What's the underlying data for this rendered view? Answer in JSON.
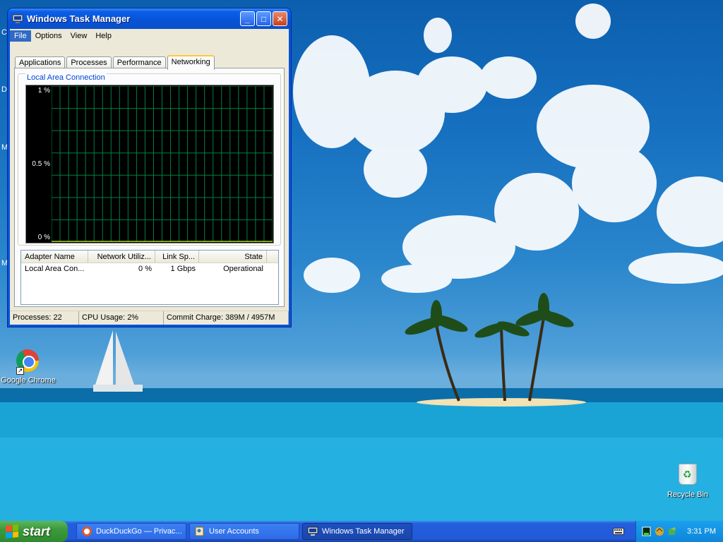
{
  "colors": {
    "graph_bg": "#000000",
    "graph_grid": "#008040",
    "title_blue": "#0a53d9",
    "tab_highlight": "#ffc83c",
    "desktop_sky": "#1670c0",
    "taskbar_blue": "#245edc",
    "start_green": "#3c9a3c"
  },
  "desktop": {
    "edge_labels": [
      "C",
      "D",
      "M",
      "M"
    ],
    "icons": [
      {
        "label": "Google Chrome",
        "icon": "chrome-icon"
      },
      {
        "label": "Recycle Bin",
        "icon": "recycle-bin-icon"
      }
    ]
  },
  "window": {
    "title": "Windows Task Manager",
    "controls": {
      "minimize": "_",
      "maximize": "□",
      "close": "✕"
    },
    "menu": [
      "File",
      "Options",
      "View",
      "Help"
    ],
    "active_menu": "File",
    "tabs": [
      "Applications",
      "Processes",
      "Performance",
      "Networking"
    ],
    "active_tab": "Networking",
    "group_label": "Local Area Connection",
    "graph": {
      "y_labels": [
        "1 %",
        "0.5 %",
        "0 %"
      ],
      "max_percent": 1,
      "utilization_percent": 0
    },
    "adapter_table": {
      "columns": [
        "Adapter Name",
        "Network Utiliz...",
        "Link Sp...",
        "State"
      ],
      "rows": [
        [
          "Local Area Con...",
          "0 %",
          "1 Gbps",
          "Operational"
        ]
      ]
    },
    "status": {
      "processes": "Processes: 22",
      "cpu": "CPU Usage: 2%",
      "commit": "Commit Charge: 389M / 4957M"
    }
  },
  "taskbar": {
    "start_label": "start",
    "tasks": [
      {
        "label": "DuckDuckGo — Privac...",
        "icon": "browser-icon",
        "active": false
      },
      {
        "label": "User Accounts",
        "icon": "user-accounts-icon",
        "active": false
      },
      {
        "label": "Windows Task Manager",
        "icon": "task-manager-icon",
        "active": true
      }
    ],
    "clock": "3:31 PM"
  }
}
